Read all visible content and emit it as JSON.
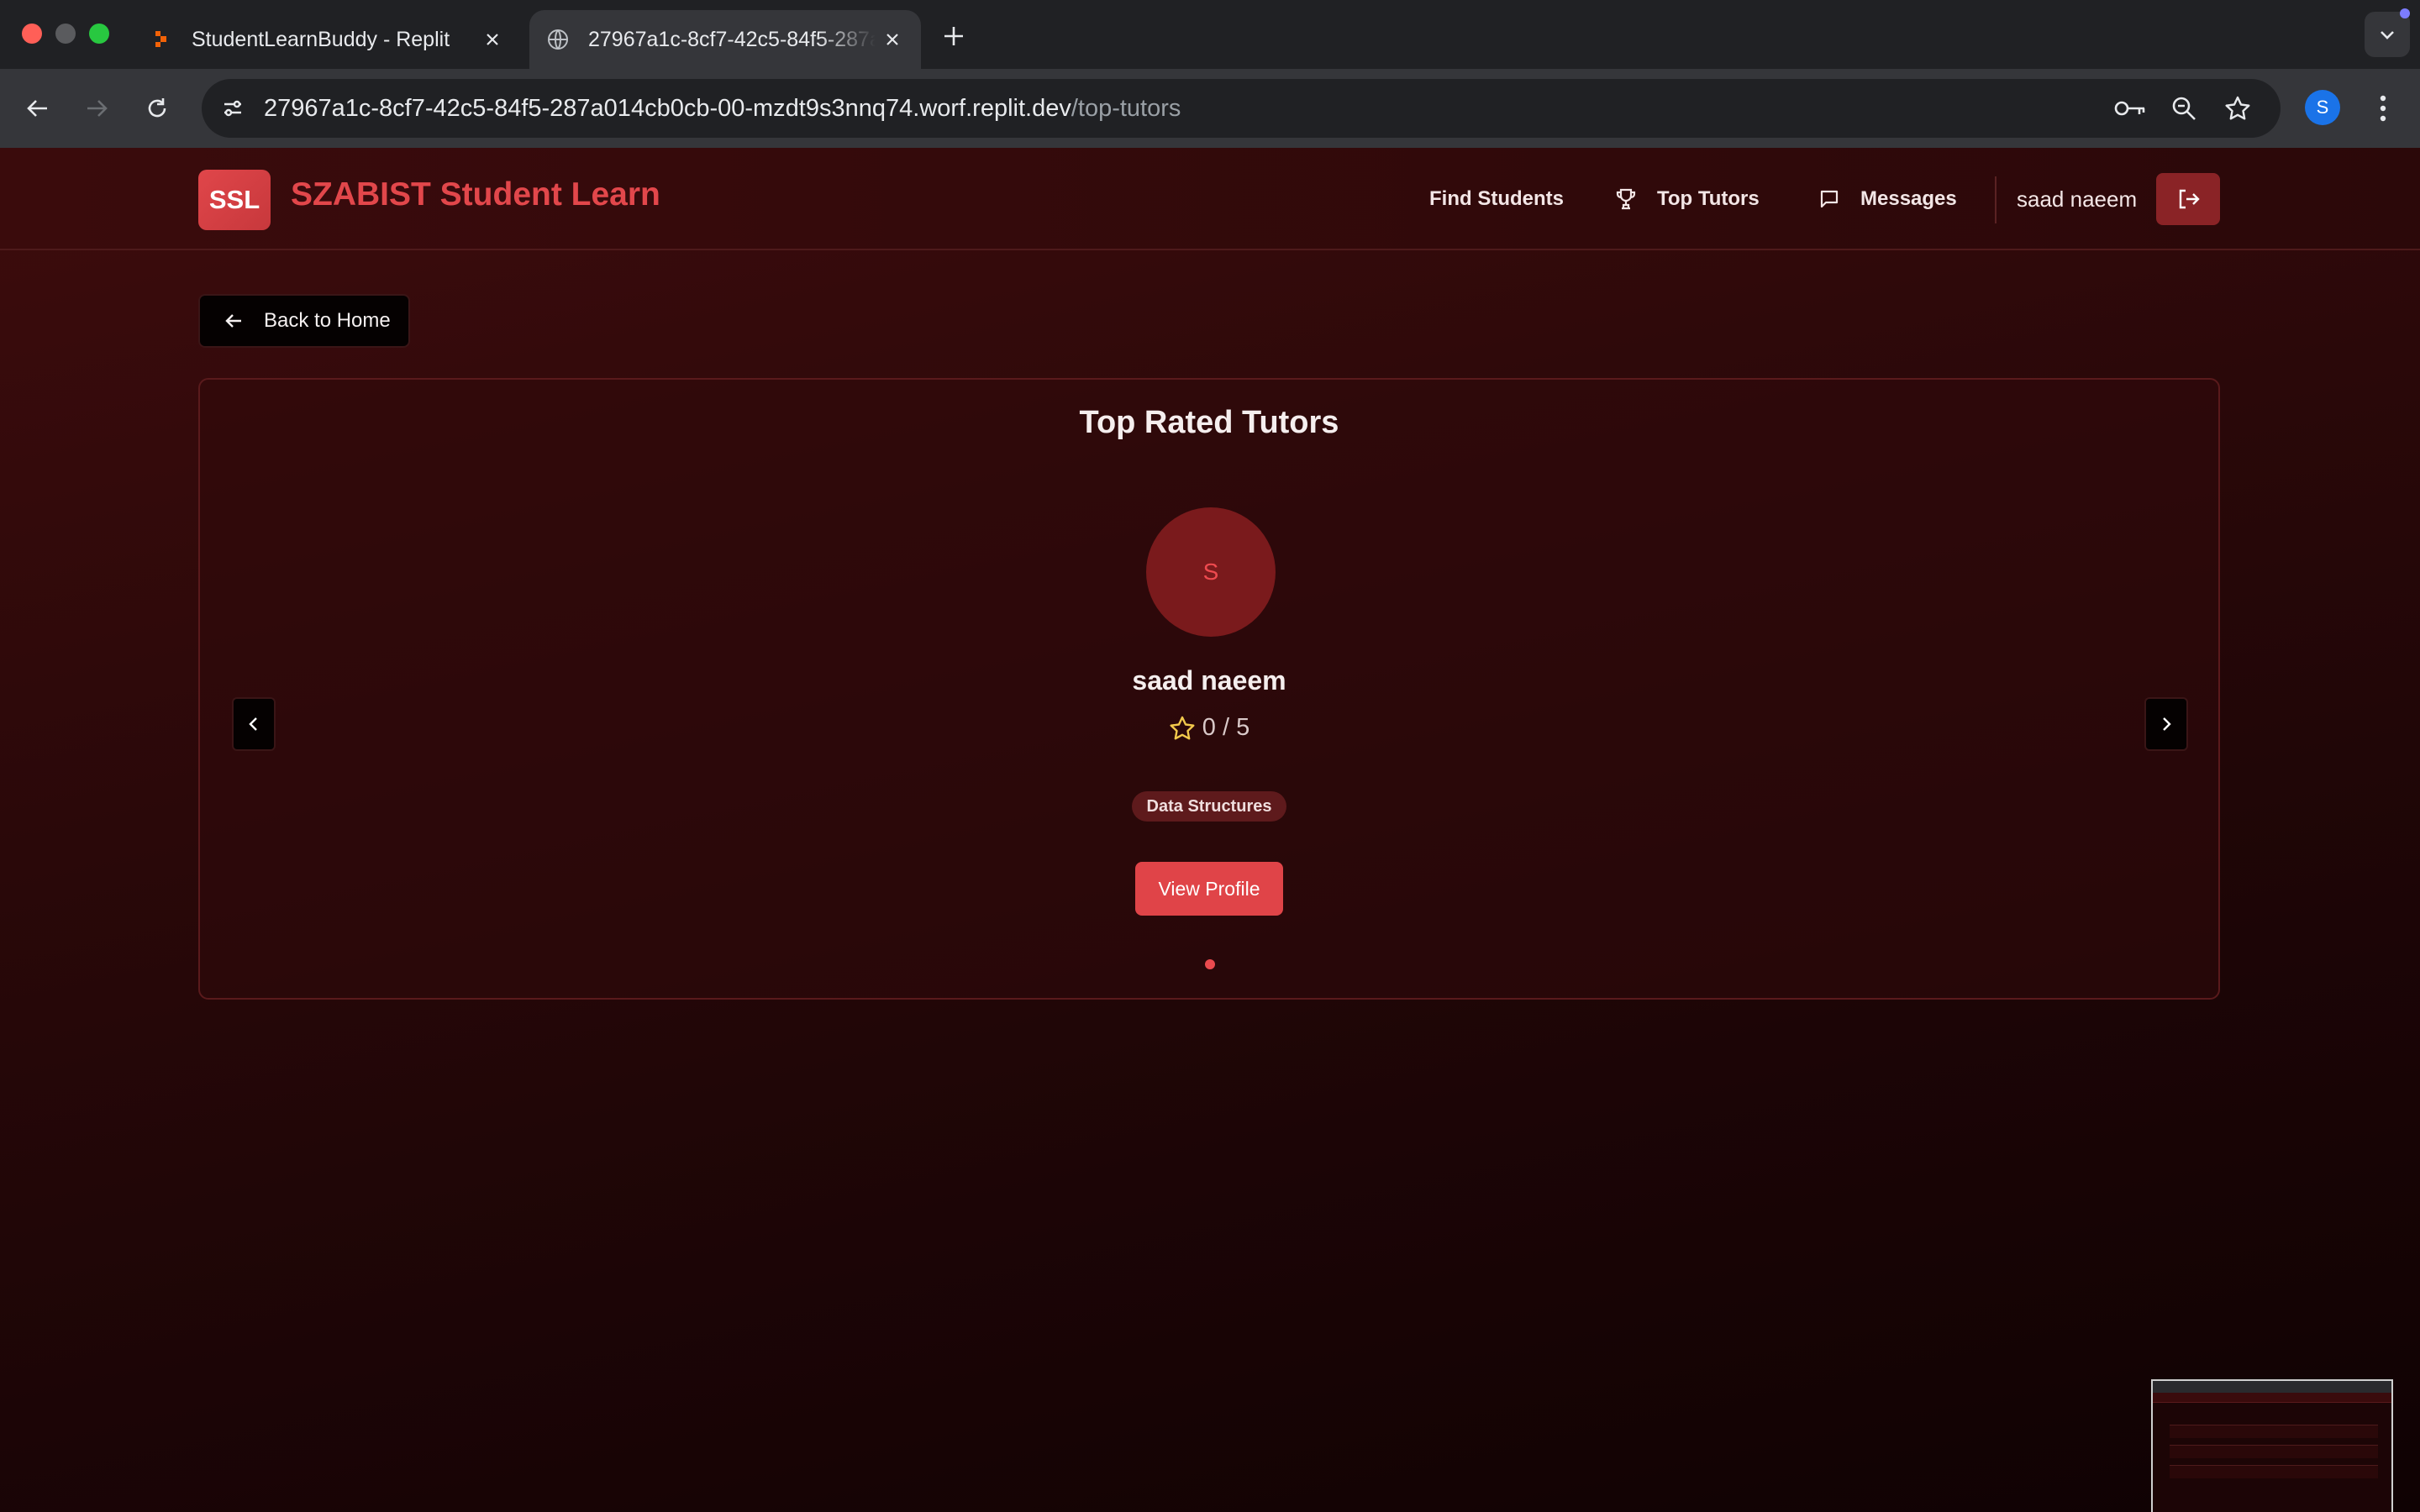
{
  "browser": {
    "tabs": [
      {
        "title": "StudentLearnBuddy - Replit",
        "favicon": "replit-icon"
      },
      {
        "title": "27967a1c-8cf7-42c5-84f5-287a014cb0cb-00-mzdt9s3nnq74.worf.replit.dev",
        "favicon": "globe-icon"
      }
    ],
    "url_host": "27967a1c-8cf7-42c5-84f5-287a014cb0cb-00-mzdt9s3nnq74.worf.replit.dev",
    "url_path": "/top-tutors",
    "profile_initial": "S"
  },
  "app": {
    "logo_text": "SSL",
    "brand": "SZABIST Student Learn",
    "nav": {
      "find_students": "Find Students",
      "top_tutors": "Top Tutors",
      "messages": "Messages"
    },
    "username": "saad naeem"
  },
  "page": {
    "back_label": "Back to Home",
    "title": "Top Rated Tutors",
    "tutor": {
      "initial": "S",
      "name": "saad naeem",
      "rating": "0 / 5",
      "subject": "Data Structures",
      "view_profile": "View Profile"
    }
  },
  "colors": {
    "accent": "#e04448",
    "brand_text": "#e2474b",
    "background": "#2a0809"
  }
}
